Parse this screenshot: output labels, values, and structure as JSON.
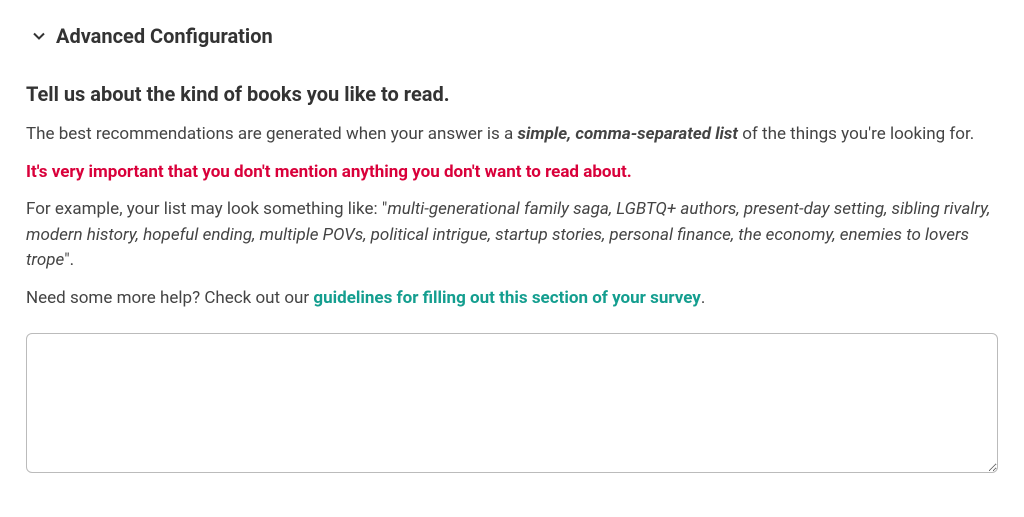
{
  "accordion": {
    "title": "Advanced Configuration"
  },
  "section": {
    "heading": "Tell us about the kind of books you like to read.",
    "intro_prefix": "The best recommendations are generated when your answer is a ",
    "intro_bold": "simple, comma-separated list",
    "intro_suffix": " of the things you're looking for.",
    "warning": "It's very important that you don't mention anything you don't want to read about.",
    "example_prefix": "For example, your list may look something like: \"",
    "example_list": "multi-generational family saga, LGBTQ+ authors, present-day setting, sibling rivalry, modern history, hopeful ending, multiple POVs, political intrigue, startup stories, personal finance, the economy, enemies to lovers trope",
    "example_suffix": "\".",
    "help_prefix": "Need some more help? Check out our ",
    "help_link": "guidelines for filling out this section of your survey",
    "help_suffix": ".",
    "textarea_value": ""
  }
}
